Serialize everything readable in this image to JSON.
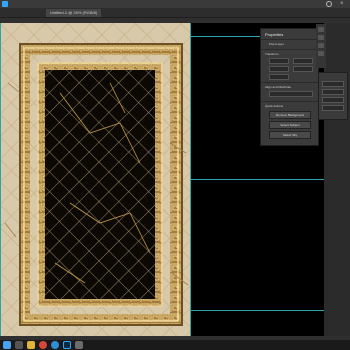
{
  "document_tab": {
    "label": "Untitled-1 @ 25% (RGB/8)"
  },
  "properties_panel": {
    "title": "Properties",
    "pixel_layer_label": "Pixel Layer",
    "sections": [
      "Transform",
      "Align and Distribute",
      "Quick Actions"
    ],
    "buttons": [
      "Remove Background",
      "Select Subject",
      "Select Sky"
    ]
  },
  "colors": {
    "canvas": "#000000",
    "ui_dark": "#262626",
    "panel": "#3b3b3b",
    "guide": "#2aa6a6",
    "rug_gold": "#b08a4e",
    "rug_cream": "#d8c9aa"
  },
  "icons": [
    "photoshop-icon",
    "search-icon",
    "close-icon",
    "chevron-down-icon",
    "move-tool-icon",
    "brush-tool-icon",
    "type-tool-icon"
  ],
  "taskbar_icons": [
    "windows-start-icon",
    "search-icon",
    "file-explorer-icon",
    "chrome-icon",
    "edge-icon",
    "photoshop-icon",
    "store-icon"
  ]
}
